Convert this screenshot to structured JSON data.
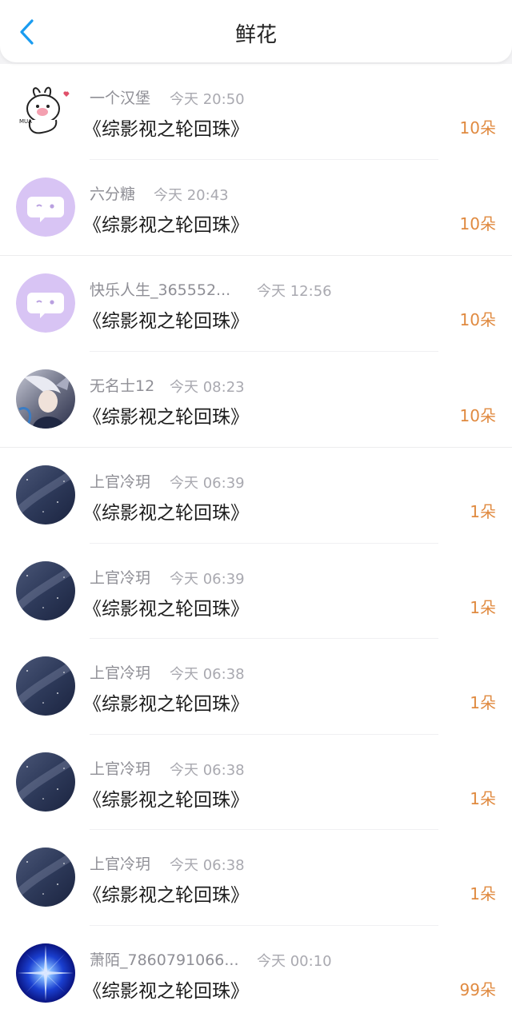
{
  "header": {
    "title": "鲜花"
  },
  "colors": {
    "accent_back": "#1a9cf0",
    "count_orange": "#e08a40"
  },
  "entries": [
    {
      "user": "一个汉堡",
      "time": "今天 20:50",
      "book": "《综影视之轮回珠》",
      "count": "10朵",
      "avatar": "bunny-sticker"
    },
    {
      "user": "六分糖",
      "time": "今天 20:43",
      "book": "《综影视之轮回珠》",
      "count": "10朵",
      "avatar": "default-chat-face"
    },
    {
      "user": "快乐人生_365552...",
      "time": "今天 12:56",
      "book": "《综影视之轮回珠》",
      "count": "10朵",
      "avatar": "default-chat-face"
    },
    {
      "user": "无名士12",
      "time": "今天 08:23",
      "book": "《综影视之轮回珠》",
      "count": "10朵",
      "avatar": "anime-character"
    },
    {
      "user": "上官冷玥",
      "time": "今天 06:39",
      "book": "《综影视之轮回珠》",
      "count": "1朵",
      "avatar": "night-sky"
    },
    {
      "user": "上官冷玥",
      "time": "今天 06:39",
      "book": "《综影视之轮回珠》",
      "count": "1朵",
      "avatar": "night-sky"
    },
    {
      "user": "上官冷玥",
      "time": "今天 06:38",
      "book": "《综影视之轮回珠》",
      "count": "1朵",
      "avatar": "night-sky"
    },
    {
      "user": "上官冷玥",
      "time": "今天 06:38",
      "book": "《综影视之轮回珠》",
      "count": "1朵",
      "avatar": "night-sky"
    },
    {
      "user": "上官冷玥",
      "time": "今天 06:38",
      "book": "《综影视之轮回珠》",
      "count": "1朵",
      "avatar": "night-sky"
    },
    {
      "user": "萧陌_7860791066...",
      "time": "今天 00:10",
      "book": "《综影视之轮回珠》",
      "count": "99朵",
      "avatar": "blue-starburst"
    }
  ]
}
